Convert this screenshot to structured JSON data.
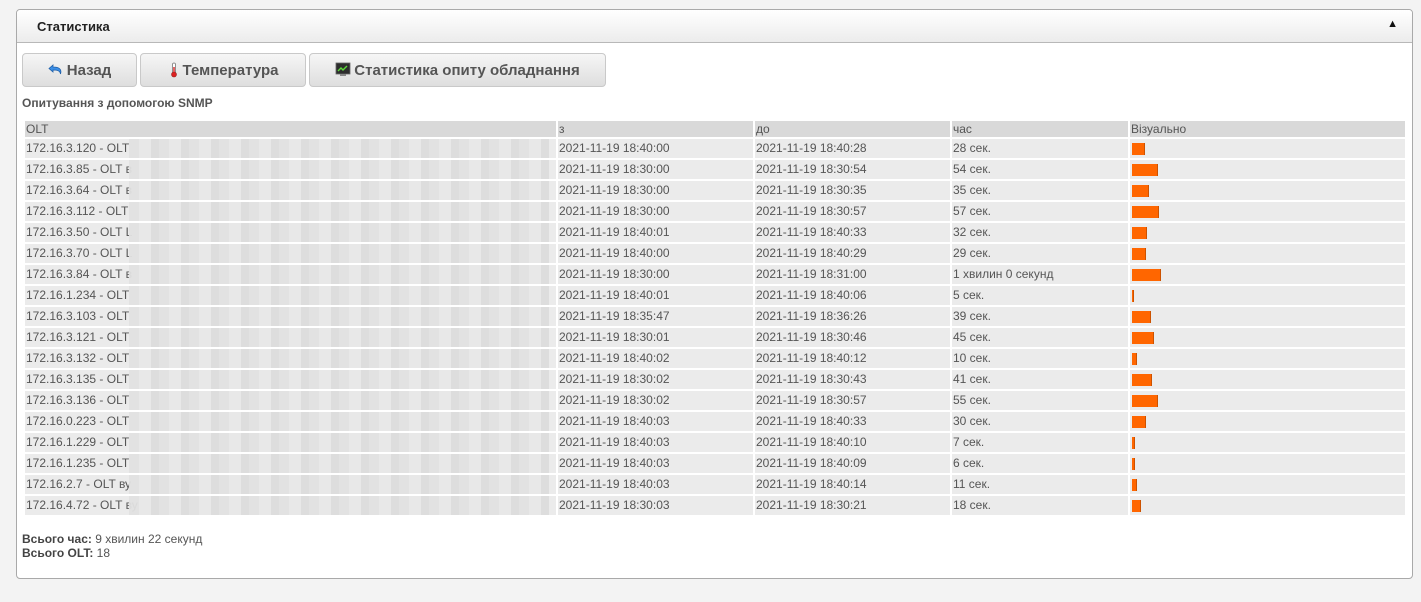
{
  "panel": {
    "title": "Статистика"
  },
  "toolbar": {
    "back_label": "Назад",
    "temperature_label": "Температура",
    "poll_stats_label": "Статистика опиту обладнання"
  },
  "section_title": "Опитування з допомогою SNMP",
  "table": {
    "headers": [
      "OLT",
      "з",
      "до",
      "час",
      "Візуально"
    ],
    "rows": [
      {
        "olt": "172.16.3.120 - OLT",
        "from": "2021-11-19 18:40:00",
        "to": "2021-11-19 18:40:28",
        "duration": "28 сек.",
        "seconds": 28
      },
      {
        "olt": "172.16.3.85 - OLT в",
        "from": "2021-11-19 18:30:00",
        "to": "2021-11-19 18:30:54",
        "duration": "54 сек.",
        "seconds": 54
      },
      {
        "olt": "172.16.3.64 - OLT в",
        "from": "2021-11-19 18:30:00",
        "to": "2021-11-19 18:30:35",
        "duration": "35 сек.",
        "seconds": 35
      },
      {
        "olt": "172.16.3.112 - OLT",
        "from": "2021-11-19 18:30:00",
        "to": "2021-11-19 18:30:57",
        "duration": "57 сек.",
        "seconds": 57
      },
      {
        "olt": "172.16.3.50 - OLT L",
        "from": "2021-11-19 18:40:01",
        "to": "2021-11-19 18:40:33",
        "duration": "32 сек.",
        "seconds": 32
      },
      {
        "olt": "172.16.3.70 - OLT L",
        "from": "2021-11-19 18:40:00",
        "to": "2021-11-19 18:40:29",
        "duration": "29 сек.",
        "seconds": 29
      },
      {
        "olt": "172.16.3.84 - OLT в",
        "from": "2021-11-19 18:30:00",
        "to": "2021-11-19 18:31:00",
        "duration": "1 хвилин 0 секунд",
        "seconds": 60
      },
      {
        "olt": "172.16.1.234 - OLT",
        "from": "2021-11-19 18:40:01",
        "to": "2021-11-19 18:40:06",
        "duration": "5 сек.",
        "seconds": 5
      },
      {
        "olt": "172.16.3.103 - OLT",
        "from": "2021-11-19 18:35:47",
        "to": "2021-11-19 18:36:26",
        "duration": "39 сек.",
        "seconds": 39
      },
      {
        "olt": "172.16.3.121 - OLT",
        "from": "2021-11-19 18:30:01",
        "to": "2021-11-19 18:30:46",
        "duration": "45 сек.",
        "seconds": 45
      },
      {
        "olt": "172.16.3.132 - OLT",
        "from": "2021-11-19 18:40:02",
        "to": "2021-11-19 18:40:12",
        "duration": "10 сек.",
        "seconds": 10
      },
      {
        "olt": "172.16.3.135 - OLT",
        "from": "2021-11-19 18:30:02",
        "to": "2021-11-19 18:30:43",
        "duration": "41 сек.",
        "seconds": 41
      },
      {
        "olt": "172.16.3.136 - OLT",
        "from": "2021-11-19 18:30:02",
        "to": "2021-11-19 18:30:57",
        "duration": "55 сек.",
        "seconds": 55
      },
      {
        "olt": "172.16.0.223 - OLT",
        "from": "2021-11-19 18:40:03",
        "to": "2021-11-19 18:40:33",
        "duration": "30 сек.",
        "seconds": 30
      },
      {
        "olt": "172.16.1.229 - OLT",
        "from": "2021-11-19 18:40:03",
        "to": "2021-11-19 18:40:10",
        "duration": "7 сек.",
        "seconds": 7
      },
      {
        "olt": "172.16.1.235 - OLT",
        "from": "2021-11-19 18:40:03",
        "to": "2021-11-19 18:40:09",
        "duration": "6 сек.",
        "seconds": 6
      },
      {
        "olt": "172.16.2.7 - OLT ву",
        "from": "2021-11-19 18:40:03",
        "to": "2021-11-19 18:40:14",
        "duration": "11 сек.",
        "seconds": 11
      },
      {
        "olt": "172.16.4.72 - OLT ву",
        "from": "2021-11-19 18:30:03",
        "to": "2021-11-19 18:30:21",
        "duration": "18 сек.",
        "seconds": 18
      }
    ]
  },
  "totals": {
    "time_label": "Всього час:",
    "time_value": "9 хвилин 22 секунд",
    "olt_label": "Всього OLT:",
    "olt_value": "18"
  },
  "colors": {
    "bar": "#ff6600",
    "header_bg": "#d9d9d9",
    "row_bg": "#ebebeb"
  },
  "icons": {
    "back": "undo-arrow-icon",
    "temperature": "thermometer-icon",
    "poll_stats": "monitor-chart-icon",
    "collapse": "triangle-up-icon"
  }
}
